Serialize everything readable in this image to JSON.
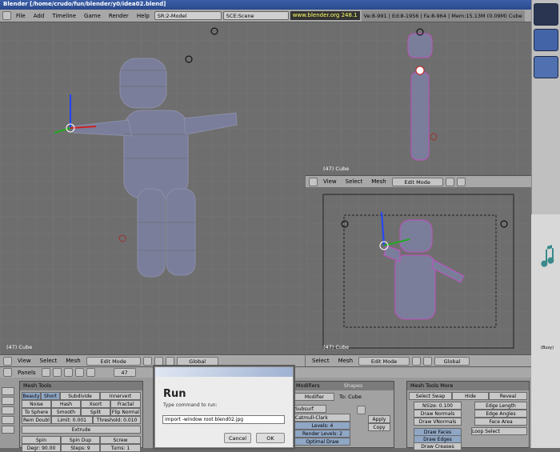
{
  "window": {
    "title": "Blender [/home/crudo/fun/blender/y0/idea02.blend]"
  },
  "menu": {
    "items": [
      "File",
      "Add",
      "Timeline",
      "Game",
      "Render",
      "Help"
    ],
    "screen": "SR:2-Model",
    "scene": "SCE:Scene",
    "site": "www.blender.org 248.1",
    "stats": "Ve:8-991 | Ed:8-1956 | Fa:8-964 | Mem:15.13M (0.09M) Cube"
  },
  "viewport_main": {
    "frame": "(47) Cube",
    "menu": [
      "View",
      "Select",
      "Mesh"
    ],
    "mode": "Edit Mode",
    "orient": "Global"
  },
  "viewport_tr": {
    "frame": "(47) Cube",
    "menu": [
      "View",
      "Select",
      "Mesh"
    ],
    "mode": "Edit Mode"
  },
  "viewport_br": {
    "frame": "(47) Cube",
    "menu": [
      "Select",
      "Mesh"
    ],
    "mode": "Edit Mode",
    "orient": "Global"
  },
  "buttons": {
    "panels_label": "Panels",
    "frame": "47"
  },
  "mesh_tools": {
    "title": "Mesh Tools",
    "row1": [
      "Beauty",
      "Short",
      "Subdivide",
      "Innervert"
    ],
    "row2": [
      "Noise",
      "Hash",
      "Xsort",
      "Fractal"
    ],
    "row3": [
      "To Sphere",
      "Smooth",
      "Split",
      "Flip Normal"
    ],
    "row4": [
      "Rem Doubl",
      "Limit: 0.001",
      "Threshold: 0.010"
    ],
    "extrude": "Extrude",
    "row6": [
      "Spin",
      "Spin Dup",
      "Screw"
    ],
    "row7": [
      "Degr: 90.00",
      "Steps: 9",
      "Turns: 1"
    ]
  },
  "modifiers": {
    "tab": "Modifiers",
    "tab2": "Shapes",
    "add": "Modifier",
    "to": "To: Cube",
    "name": "Subsurf",
    "type": "Catmull-Clark",
    "levels": "Levels: 4",
    "render_levels": "Render Levels: 2",
    "optimal": "Optimal Draw",
    "apply": "Apply",
    "copy": "Copy"
  },
  "mesh_tools_more": {
    "title": "Mesh Tools More",
    "top": [
      "Select Swap",
      "Hide",
      "Reveal"
    ],
    "nsize": "NSize: 0.100",
    "draw_normals": "Draw Normals",
    "draw_vnormals": "Draw VNormals",
    "edge_length": "Edge Length",
    "edge_angles": "Edge Angles",
    "face_area": "Face Area",
    "draw_faces": "Draw Faces",
    "draw_edges": "Draw Edges",
    "draw_creases": "Draw Creases",
    "loop_select": "Loop Select"
  },
  "run_dialog": {
    "title": "Run",
    "prompt": "Type command to run:",
    "value": "import -window root blend02.jpg",
    "cancel": "Cancel",
    "ok": "OK"
  },
  "taskbar": {
    "tray_text": "(Busy)"
  }
}
